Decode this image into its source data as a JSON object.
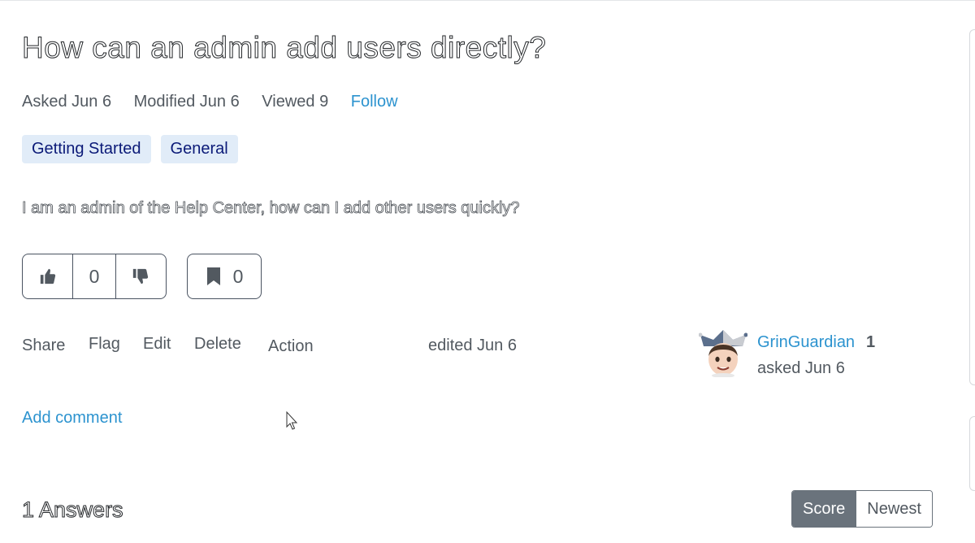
{
  "question": {
    "title": "How can an admin add users directly?",
    "meta": {
      "asked": "Asked Jun 6",
      "modified": "Modified Jun 6",
      "viewed": "Viewed 9",
      "follow_label": "Follow"
    },
    "tags": [
      "Getting Started",
      "General"
    ],
    "body": "I am an admin of the Help Center, how can I add other users quickly?",
    "votes": {
      "count": "0",
      "up_icon": "thumbs-up-icon",
      "down_icon": "thumbs-down-icon"
    },
    "bookmarks": {
      "count": "0",
      "icon": "bookmark-icon"
    },
    "actions": {
      "share": "Share",
      "flag": "Flag",
      "edit": "Edit",
      "delete": "Delete",
      "action": "Action"
    },
    "edited": "edited Jun 6",
    "author": {
      "name": "GrinGuardian",
      "reputation": "1",
      "asked": "asked Jun 6",
      "avatar_icon": "jester-avatar-icon"
    },
    "add_comment_label": "Add comment"
  },
  "answers": {
    "heading": "1 Answers",
    "sort": {
      "active": "Score",
      "inactive": "Newest"
    }
  },
  "colors": {
    "link": "#2c93cf",
    "tag_bg": "#e1ecf8",
    "tag_text": "#0b1a78",
    "sort_active_bg": "#6a737c",
    "border": "#4a5361"
  }
}
